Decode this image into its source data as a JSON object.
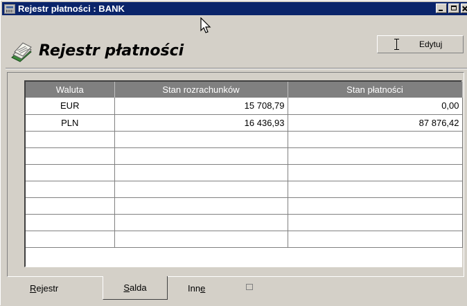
{
  "window": {
    "title": "Rejestr płatności : BANK"
  },
  "header": {
    "title": "Rejestr płatności",
    "edit_button_label": "Edytuj"
  },
  "grid": {
    "columns": [
      "Waluta",
      "Stan rozrachunków",
      "Stan płatności"
    ],
    "rows": [
      {
        "waluta": "EUR",
        "rozrachunki": "15 708,79",
        "platnosci": "0,00"
      },
      {
        "waluta": "PLN",
        "rozrachunki": "16 436,93",
        "platnosci": "87 876,42"
      }
    ]
  },
  "tabs": [
    {
      "prefix": "",
      "underlined": "R",
      "suffix": "ejestr",
      "active": false
    },
    {
      "prefix": "",
      "underlined": "S",
      "suffix": "alda",
      "active": true
    },
    {
      "prefix": "Inn",
      "underlined": "e",
      "suffix": "",
      "active": false
    }
  ],
  "colors": {
    "titlebar": "#0a246a",
    "window_bg": "#d4d0c8",
    "grid_header": "#808080"
  }
}
